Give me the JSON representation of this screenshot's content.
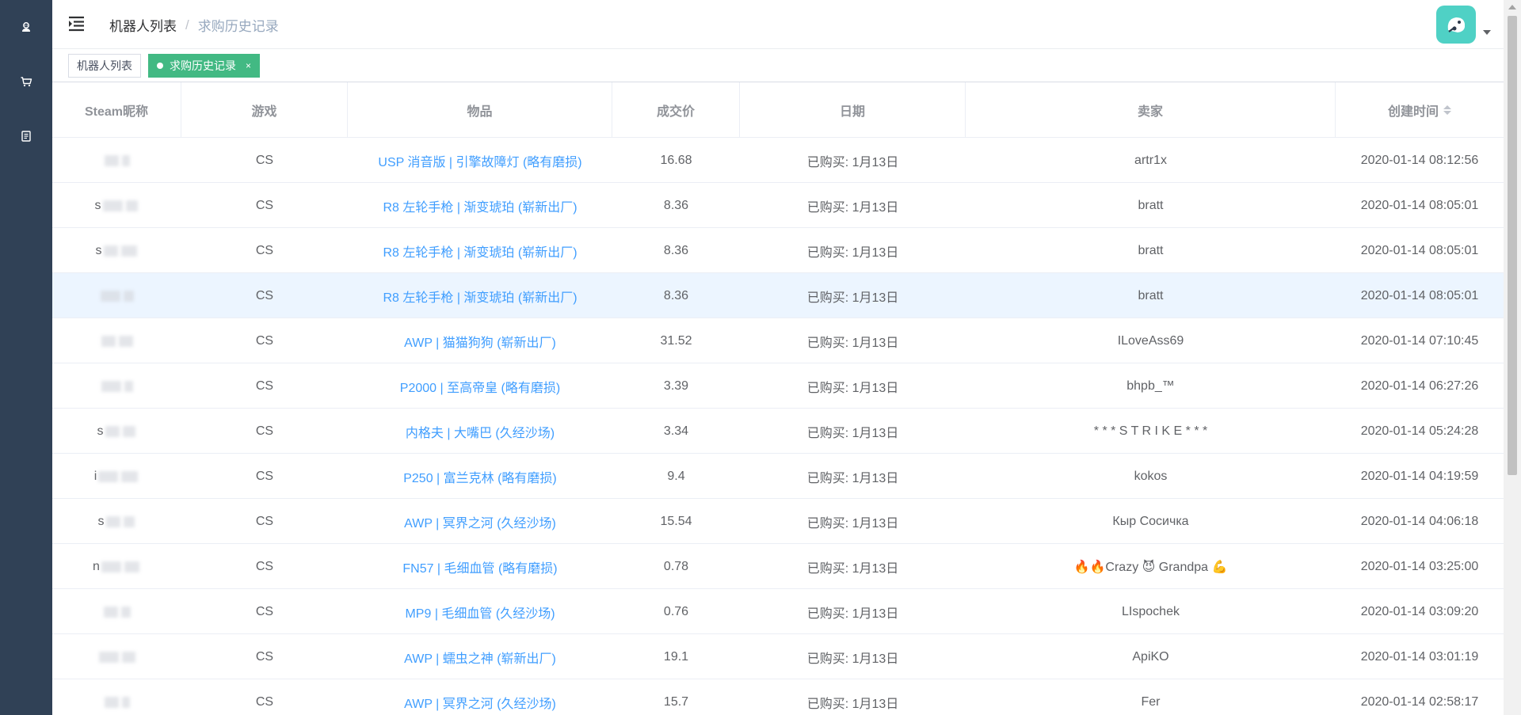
{
  "sidebar": {
    "items": [
      {
        "name": "robot-icon"
      },
      {
        "name": "cart-icon"
      },
      {
        "name": "document-icon"
      }
    ]
  },
  "navbar": {
    "breadcrumb": [
      "机器人列表",
      "求购历史记录"
    ],
    "separator": "/"
  },
  "tags": [
    {
      "label": "机器人列表",
      "active": false
    },
    {
      "label": "求购历史记录",
      "active": true,
      "close": "×"
    }
  ],
  "table": {
    "columns": [
      "Steam昵称",
      "游戏",
      "物品",
      "成交价",
      "日期",
      "卖家",
      "创建时间"
    ],
    "rows": [
      {
        "nick": "",
        "game": "CS",
        "item": "USP 消音版 | 引擎故障灯 (略有磨损)",
        "price": "16.68",
        "date": "已购买: 1月13日",
        "seller": "artr1x",
        "created": "2020-01-14 08:12:56"
      },
      {
        "nick": "s",
        "game": "CS",
        "item": "R8 左轮手枪 | 渐变琥珀 (崭新出厂)",
        "price": "8.36",
        "date": "已购买: 1月13日",
        "seller": "bratt",
        "created": "2020-01-14 08:05:01"
      },
      {
        "nick": "s",
        "game": "CS",
        "item": "R8 左轮手枪 | 渐变琥珀 (崭新出厂)",
        "price": "8.36",
        "date": "已购买: 1月13日",
        "seller": "bratt",
        "created": "2020-01-14 08:05:01"
      },
      {
        "nick": "",
        "game": "CS",
        "item": "R8 左轮手枪 | 渐变琥珀 (崭新出厂)",
        "price": "8.36",
        "date": "已购买: 1月13日",
        "seller": "bratt",
        "created": "2020-01-14 08:05:01"
      },
      {
        "nick": "",
        "game": "CS",
        "item": "AWP | 猫猫狗狗 (崭新出厂)",
        "price": "31.52",
        "date": "已购买: 1月13日",
        "seller": "ILoveAss69",
        "created": "2020-01-14 07:10:45"
      },
      {
        "nick": "",
        "game": "CS",
        "item": "P2000 | 至高帝皇 (略有磨损)",
        "price": "3.39",
        "date": "已购买: 1月13日",
        "seller": "bhpb_™",
        "created": "2020-01-14 06:27:26"
      },
      {
        "nick": "s",
        "game": "CS",
        "item": "内格夫 | 大嘴巴 (久经沙场)",
        "price": "3.34",
        "date": "已购买: 1月13日",
        "seller": "* * * S T R I K E * * *",
        "created": "2020-01-14 05:24:28"
      },
      {
        "nick": "i",
        "game": "CS",
        "item": "P250 | 富兰克林 (略有磨损)",
        "price": "9.4",
        "date": "已购买: 1月13日",
        "seller": "kokos",
        "created": "2020-01-14 04:19:59"
      },
      {
        "nick": "s",
        "game": "CS",
        "item": "AWP | 冥界之河 (久经沙场)",
        "price": "15.54",
        "date": "已购买: 1月13日",
        "seller": "Кыр Сосичка",
        "created": "2020-01-14 04:06:18"
      },
      {
        "nick": "n",
        "game": "CS",
        "item": "FN57 | 毛细血管 (略有磨损)",
        "price": "0.78",
        "date": "已购买: 1月13日",
        "seller": "🔥🔥Crazy 😈 Grandpa 💪",
        "created": "2020-01-14 03:25:00"
      },
      {
        "nick": "",
        "game": "CS",
        "item": "MP9 | 毛细血管 (久经沙场)",
        "price": "0.76",
        "date": "已购买: 1月13日",
        "seller": "LIspochek",
        "created": "2020-01-14 03:09:20"
      },
      {
        "nick": "",
        "game": "CS",
        "item": "AWP | 蠕虫之神 (崭新出厂)",
        "price": "19.1",
        "date": "已购买: 1月13日",
        "seller": "ApiKO",
        "created": "2020-01-14 03:01:19"
      },
      {
        "nick": "",
        "game": "CS",
        "item": "AWP | 冥界之河 (久经沙场)",
        "price": "15.7",
        "date": "已购买: 1月13日",
        "seller": "Fer",
        "created": "2020-01-14 02:58:17"
      }
    ]
  },
  "colors": {
    "sidebar": "#304156",
    "accent_tag": "#42b983",
    "link": "#409eff",
    "avatar": "#4fd1c5",
    "row_hover": "#ecf5ff"
  }
}
